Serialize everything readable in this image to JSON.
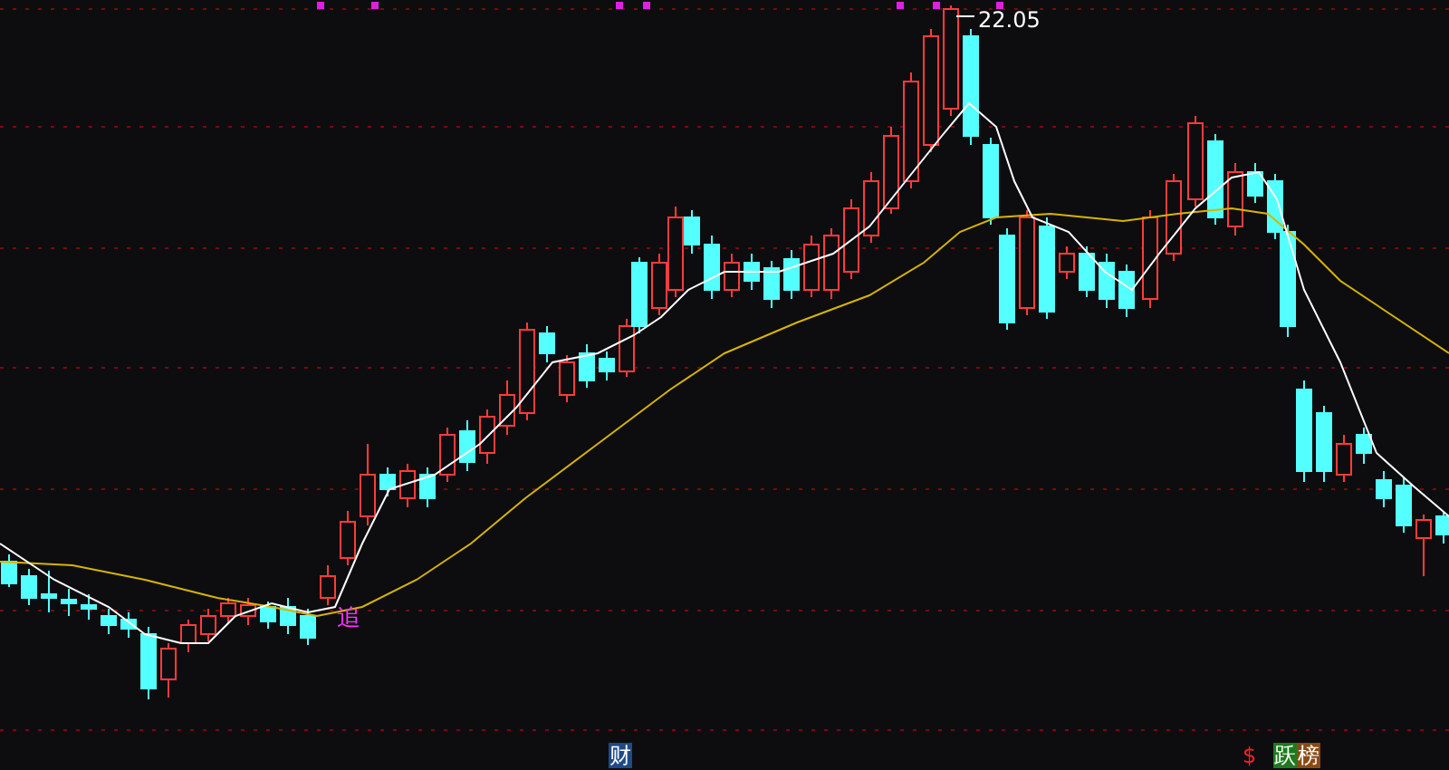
{
  "chart": {
    "high_label": "22.05",
    "signal_marker": "追"
  },
  "badges": [
    {
      "label": "财",
      "kind": "tag",
      "color": "#1e4a86"
    },
    {
      "label": "$",
      "kind": "text",
      "color": "#ff2020"
    },
    {
      "label": "跃",
      "kind": "tag",
      "color": "#1f7a1f"
    },
    {
      "label": "榜",
      "kind": "tag",
      "color": "#8a4a14"
    }
  ]
}
